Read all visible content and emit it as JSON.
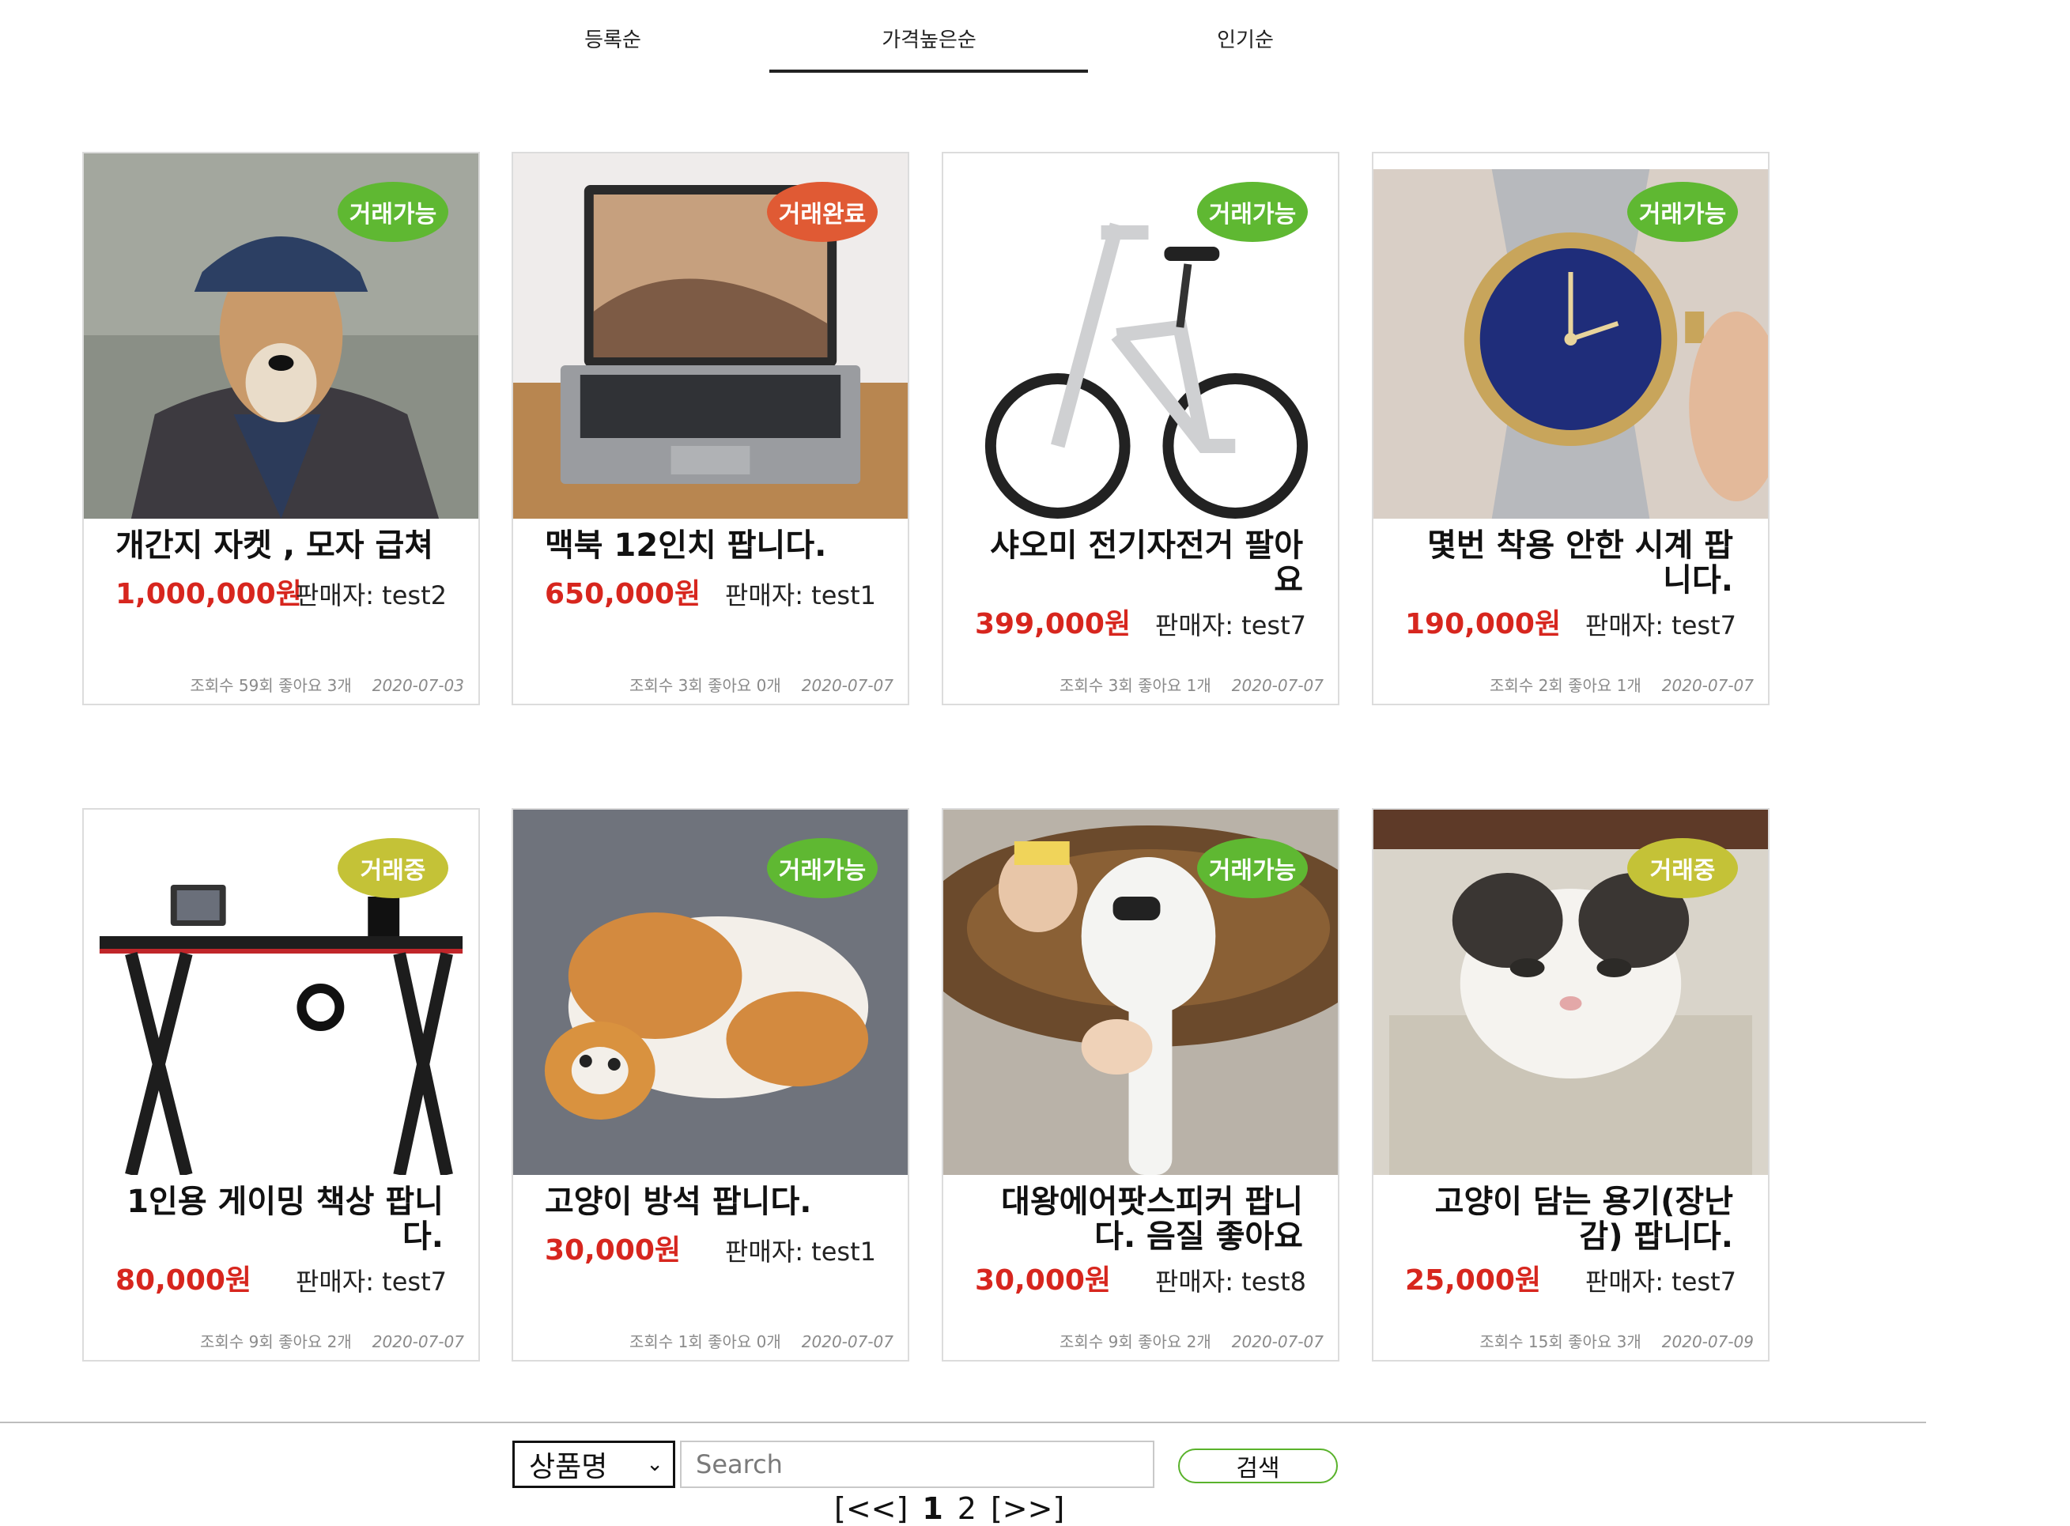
{
  "sort_tabs": [
    {
      "label": "등록순"
    },
    {
      "label": "가격높은순"
    },
    {
      "label": "인기순"
    }
  ],
  "active_tab_index": 1,
  "products": [
    {
      "title": "개간지 자켓 , 모자 급쳐",
      "price": "1,000,000원",
      "seller": "판매자: test2",
      "stats": "조회수 59회 좋아요 3개",
      "date": "2020-07-03",
      "status": "거래가능",
      "status_color": "#5fb832"
    },
    {
      "title": "맥북 12인치 팝니다.",
      "price": "650,000원",
      "seller": "판매자: test1",
      "stats": "조회수 3회 좋아요 0개",
      "date": "2020-07-07",
      "status": "거래완료",
      "status_color": "#e05a34"
    },
    {
      "title": "샤오미 전기자전거 팔아요",
      "price": "399,000원",
      "seller": "판매자: test7",
      "stats": "조회수 3회 좋아요 1개",
      "date": "2020-07-07",
      "status": "거래가능",
      "status_color": "#5fb832"
    },
    {
      "title": "몇번 착용 안한 시계 팝니다.",
      "price": "190,000원",
      "seller": "판매자: test7",
      "stats": "조회수 2회 좋아요 1개",
      "date": "2020-07-07",
      "status": "거래가능",
      "status_color": "#5fb832"
    },
    {
      "title": "1인용 게이밍 책상 팝니다.",
      "price": "80,000원",
      "seller": "판매자: test7",
      "stats": "조회수 9회 좋아요 2개",
      "date": "2020-07-07",
      "status": "거래중",
      "status_color": "#c4c237"
    },
    {
      "title": "고양이 방석 팝니다.",
      "price": "30,000원",
      "seller": "판매자: test1",
      "stats": "조회수 1회 좋아요 0개",
      "date": "2020-07-07",
      "status": "거래가능",
      "status_color": "#5fb832"
    },
    {
      "title": "대왕에어팟스피커 팝니다. 음질 좋아요",
      "price": "30,000원",
      "seller": "판매자: test8",
      "stats": "조회수 9회 좋아요 2개",
      "date": "2020-07-07",
      "status": "거래가능",
      "status_color": "#5fb832"
    },
    {
      "title": "고양이 담는 용기(장난감) 팝니다.",
      "price": "25,000원",
      "seller": "판매자: test7",
      "stats": "조회수 15회 좋아요 3개",
      "date": "2020-07-09",
      "status": "거래중",
      "status_color": "#c4c237"
    }
  ],
  "search": {
    "select_value": "상품명",
    "placeholder": "Search",
    "button_label": "검색"
  },
  "pagination": {
    "first": "[<<]",
    "pages": [
      "1",
      "2"
    ],
    "last": "[>>]"
  }
}
